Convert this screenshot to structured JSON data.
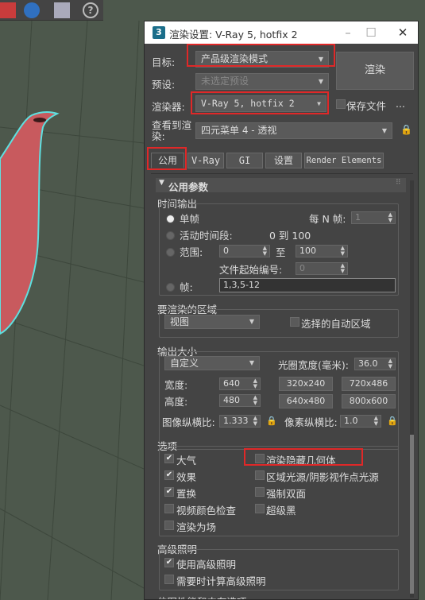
{
  "dialog": {
    "title": "渲染设置: V-Ray 5, hotfix 2",
    "target_label": "目标:",
    "target_value": "产品级渲染模式",
    "preset_label": "预设:",
    "preset_value": "未选定预设",
    "renderer_label": "渲染器:",
    "renderer_value": "V-Ray 5, hotfix 2",
    "save_file_label": "保存文件",
    "ellipsis": "...",
    "view_label": "查看到渲染:",
    "view_value": "四元菜单 4 - 透视",
    "render_button": "渲染"
  },
  "tabs": [
    "公用",
    "V-Ray",
    "GI",
    "设置",
    "Render Elements"
  ],
  "rollout": {
    "title": "公用参数",
    "time_output": {
      "title": "时间输出",
      "single": "单帧",
      "every_n": "每 N 帧:",
      "every_n_value": "1",
      "active_segment": "活动时间段:",
      "active_range": "0 到 100",
      "range": "范围:",
      "range_from": "0",
      "to": "至",
      "range_to": "100",
      "file_start": "文件起始编号:",
      "file_start_value": "0",
      "frames": "帧:",
      "frames_value": "1,3,5-12"
    },
    "area": {
      "title": "要渲染的区域",
      "value": "视图",
      "auto_region": "选择的自动区域"
    },
    "output_size": {
      "title": "输出大小",
      "preset": "自定义",
      "aperture_label": "光圈宽度(毫米):",
      "aperture_value": "36.0",
      "width_label": "宽度:",
      "width_value": "640",
      "height_label": "高度:",
      "height_value": "480",
      "res_buttons": [
        "320x240",
        "720x486",
        "640x480",
        "800x600"
      ],
      "aspect_label": "图像纵横比:",
      "aspect_value": "1.333",
      "pixel_aspect_label": "像素纵横比:",
      "pixel_aspect_value": "1.0"
    },
    "options": {
      "title": "选项",
      "atmosphere": "大气",
      "render_hidden": "渲染隐藏几何体",
      "effects": "效果",
      "area_lights": "区域光源/阴影视作点光源",
      "displacement": "置换",
      "force_two_sided": "强制双面",
      "video_color_check": "视频颜色检查",
      "super_black": "超级黑",
      "render_to_fields": "渲染为场"
    },
    "advanced_lighting": {
      "title": "高级照明",
      "use": "使用高级照明",
      "compute": "需要时计算高级照明"
    },
    "partial_text": "位图性能和内存选项"
  },
  "colors": {
    "teapot": "#c85a5e",
    "highlight": "#e02828",
    "outline": "#5ee0e0"
  }
}
